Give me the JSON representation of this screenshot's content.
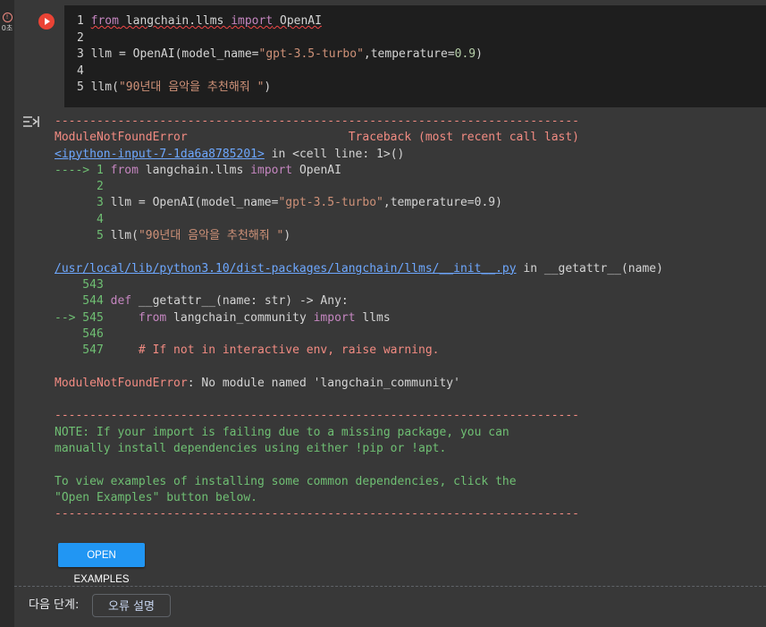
{
  "gutter": {
    "error_icon": "!",
    "error_label": "0초"
  },
  "cell": {
    "run_button_icon": "play-icon",
    "code": [
      {
        "n": "1",
        "parts": [
          [
            "squig kw",
            "from"
          ],
          [
            "squig",
            " langchain.llms "
          ],
          [
            "squig kw",
            "import"
          ],
          [
            "squig",
            " OpenAI"
          ]
        ]
      },
      {
        "n": "2",
        "parts": []
      },
      {
        "n": "3",
        "parts": [
          [
            "",
            "llm = OpenAI(model_name="
          ],
          [
            "str",
            "\"gpt-3.5-turbo\""
          ],
          [
            "",
            ",temperature="
          ],
          [
            "num",
            "0.9"
          ],
          [
            "",
            ")"
          ]
        ]
      },
      {
        "n": "4",
        "parts": []
      },
      {
        "n": "5",
        "parts": [
          [
            "",
            "llm("
          ],
          [
            "str",
            "\"90년대 음악을 추천해줘 \""
          ],
          [
            "",
            ")"
          ]
        ]
      }
    ]
  },
  "output": {
    "icon": "output-toggle-icon",
    "traceback": [
      [
        [
          "dash",
          "---------------------------------------------------------------------------"
        ]
      ],
      [
        [
          "red",
          "ModuleNotFoundError                       Traceback (most recent call last)"
        ]
      ],
      [
        [
          "blue",
          "<ipython-input-7-1da6a8785201>"
        ],
        [
          "",
          " in <cell line: 1>()"
        ]
      ],
      [
        [
          "green",
          "----> 1 "
        ],
        [
          "kw",
          "from"
        ],
        [
          "",
          " langchain.llms "
        ],
        [
          "kw",
          "import"
        ],
        [
          "",
          " OpenAI"
        ]
      ],
      [
        [
          "green",
          "      2"
        ]
      ],
      [
        [
          "green",
          "      3 "
        ],
        [
          "",
          "llm = OpenAI(model_name="
        ],
        [
          "str",
          "\"gpt-3.5-turbo\""
        ],
        [
          "",
          ",temperature=0.9)"
        ]
      ],
      [
        [
          "green",
          "      4"
        ]
      ],
      [
        [
          "green",
          "      5 "
        ],
        [
          "",
          "llm("
        ],
        [
          "str",
          "\"90년대 음악을 추천해줘 \""
        ],
        [
          "",
          ")"
        ]
      ],
      [],
      [
        [
          "blue",
          "/usr/local/lib/python3.10/dist-packages/langchain/llms/__init__.py"
        ],
        [
          "",
          " in __getattr__(name)"
        ]
      ],
      [
        [
          "green",
          "    543"
        ]
      ],
      [
        [
          "green",
          "    544 "
        ],
        [
          "kw",
          "def"
        ],
        [
          "",
          " __getattr__(name: str) -> Any:"
        ]
      ],
      [
        [
          "green",
          "--> 545     "
        ],
        [
          "kw",
          "from"
        ],
        [
          "",
          " langchain_community "
        ],
        [
          "kw",
          "import"
        ],
        [
          "",
          " llms"
        ]
      ],
      [
        [
          "green",
          "    546"
        ]
      ],
      [
        [
          "green",
          "    547     "
        ],
        [
          "red",
          "# If not in interactive env, raise warning."
        ]
      ],
      [],
      [
        [
          "red",
          "ModuleNotFoundError"
        ],
        [
          "",
          ": No module named 'langchain_community'"
        ]
      ],
      [],
      [
        [
          "dash",
          "---------------------------------------------------------------------------"
        ]
      ],
      [
        [
          "green",
          "NOTE: If your import is failing due to a missing package, you can"
        ]
      ],
      [
        [
          "green",
          "manually install dependencies using either !pip or !apt."
        ]
      ],
      [],
      [
        [
          "green",
          "To view examples of installing some common dependencies, click the"
        ]
      ],
      [
        [
          "green",
          "\"Open Examples\" button below."
        ]
      ],
      [
        [
          "dash",
          "---------------------------------------------------------------------------"
        ]
      ]
    ],
    "open_examples_label": "OPEN EXAMPLES"
  },
  "footer": {
    "next_steps_label": "다음 단계:",
    "explain_error_label": "오류 설명"
  }
}
